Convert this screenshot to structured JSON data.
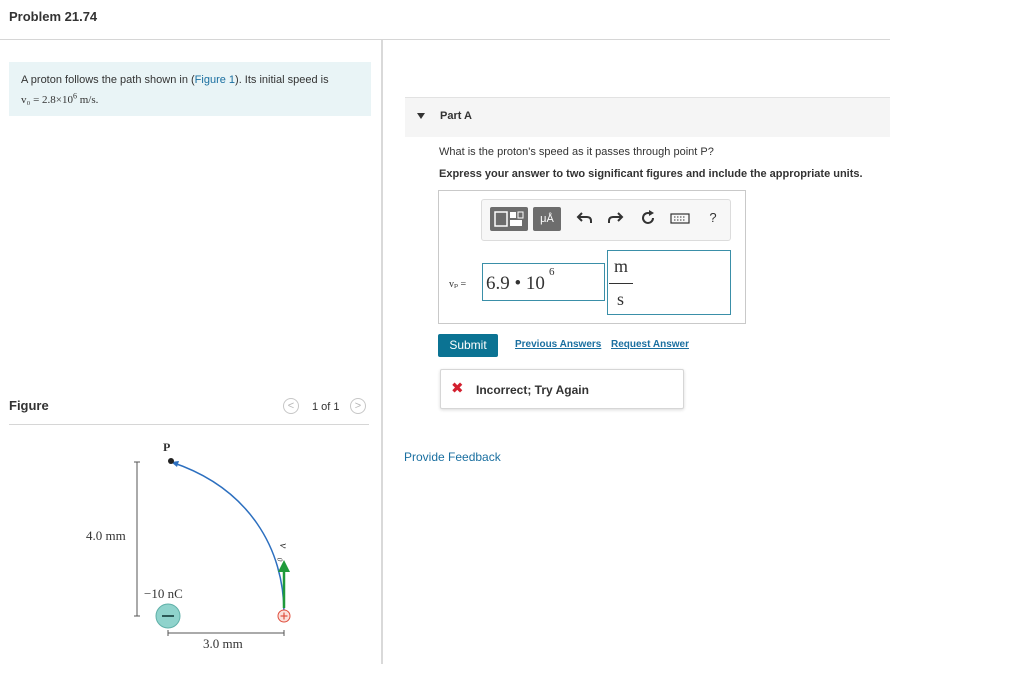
{
  "page": {
    "problem_title": "Problem 21.74"
  },
  "prompt": {
    "text_before": "A proton follows the path shown in (",
    "figure_link": "Figure 1",
    "text_after": "). Its initial speed is",
    "v0_expr": "v₀ = 2.8×10",
    "v0_exp": "6",
    "v0_units": " m/s."
  },
  "figure": {
    "label": "Figure",
    "pager_text": "1 of 1",
    "prev_glyph": "<",
    "next_glyph": ">",
    "point_label": "P",
    "height_label": "4.0 mm",
    "width_label": "3.0 mm",
    "charge_label": "−10 nC",
    "velocity_label": "v⃗₀",
    "colors": {
      "path": "#2c6fbf",
      "velocity": "#1f9a3a",
      "negative_charge": "#8fd3cc",
      "proton": "#e0503f"
    }
  },
  "part_a": {
    "label": "Part A",
    "question": "What is the proton's speed as it passes through point P?",
    "instructions": "Express your answer to two significant figures and include the appropriate units.",
    "toolbar": {
      "units_btn": "μÅ",
      "undo_icon": "undo-arrow",
      "redo_icon": "redo-arrow",
      "reset_icon": "reset-circle",
      "keyboard_icon": "keyboard",
      "help": "?"
    },
    "variable_label": "vₚ =",
    "value": "6.9 • 10",
    "value_exponent": "6",
    "unit_numerator": "m",
    "unit_denominator": "s",
    "submit": "Submit",
    "previous_answers": "Previous Answers",
    "request_answer": "Request Answer",
    "feedback_icon": "✖",
    "feedback": "Incorrect; Try Again",
    "provide_feedback": "Provide Feedback"
  }
}
